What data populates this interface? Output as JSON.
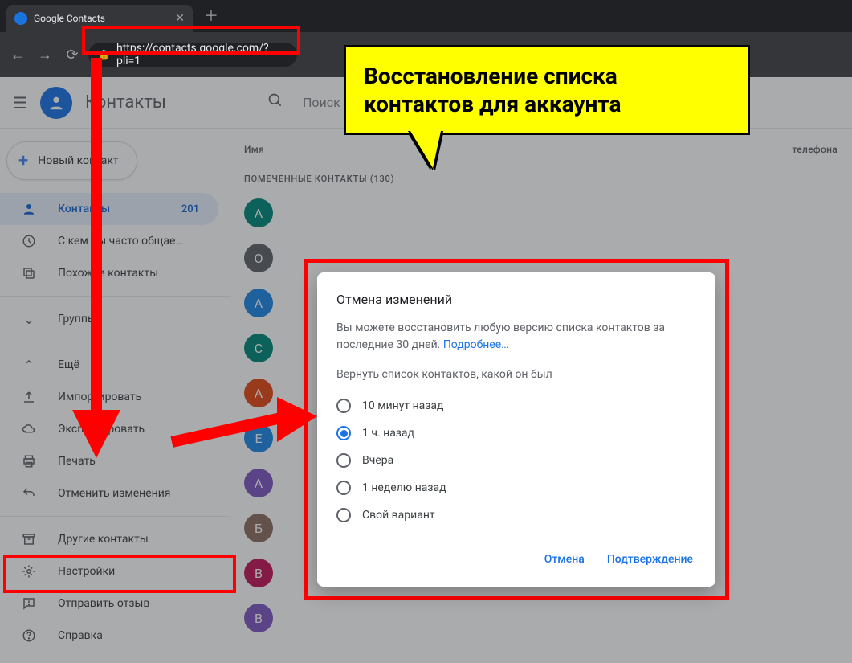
{
  "browser": {
    "tab_title": "Google Contacts",
    "url_display": "https://contacts.google.com/?pli=1"
  },
  "header": {
    "app_name": "Контакты",
    "search_placeholder": "Поиск"
  },
  "sidebar": {
    "new_contact": "Новый контакт",
    "items": [
      {
        "icon": "person",
        "label": "Контакты",
        "count": "201",
        "active": true
      },
      {
        "icon": "history",
        "label": "С кем вы часто общае…"
      },
      {
        "icon": "copy",
        "label": "Похожие контакты"
      }
    ],
    "groups_label": "Группы",
    "more_label": "Ещё",
    "more_items": [
      {
        "icon": "upload",
        "label": "Импортировать"
      },
      {
        "icon": "cloud",
        "label": "Экспортировать"
      },
      {
        "icon": "print",
        "label": "Печать"
      },
      {
        "icon": "undo",
        "label": "Отменить изменения"
      }
    ],
    "footer": [
      {
        "icon": "archive",
        "label": "Другие контакты"
      },
      {
        "icon": "gear",
        "label": "Настройки"
      },
      {
        "icon": "feedback",
        "label": "Отправить отзыв"
      },
      {
        "icon": "help",
        "label": "Справка"
      }
    ]
  },
  "content": {
    "col_name": "Имя",
    "col_phone": "телефона",
    "section": "ПОМЕЧЕННЫЕ КОНТАКТЫ (130)",
    "rows": [
      {
        "letter": "А",
        "color": "#00897b"
      },
      {
        "letter": "О",
        "color": "#5f6368"
      },
      {
        "letter": "А",
        "color": "#1e88e5"
      },
      {
        "letter": "С",
        "color": "#00897b"
      },
      {
        "letter": "А",
        "color": "#e64a19"
      },
      {
        "letter": "Е",
        "color": "#1e88e5"
      },
      {
        "letter": "А",
        "color": "#7e57c2"
      },
      {
        "letter": "Б",
        "color": "#8d6e63"
      },
      {
        "letter": "В",
        "color": "#c2185b"
      },
      {
        "letter": "В",
        "color": "#7e57c2"
      }
    ]
  },
  "callout": {
    "text": "Восстановление списка контактов для аккаунта"
  },
  "dialog": {
    "title": "Отмена изменений",
    "desc": "Вы можете восстановить любую версию списка контактов за последние 30 дней. ",
    "more": "Подробнее…",
    "subtitle": "Вернуть список контактов, какой он был",
    "options": [
      {
        "label": "10 минут назад",
        "checked": false
      },
      {
        "label": "1 ч. назад",
        "checked": true
      },
      {
        "label": "Вчера",
        "checked": false
      },
      {
        "label": "1 неделю назад",
        "checked": false
      },
      {
        "label": "Свой вариант",
        "checked": false
      }
    ],
    "cancel": "Отмена",
    "confirm": "Подтверждение"
  }
}
